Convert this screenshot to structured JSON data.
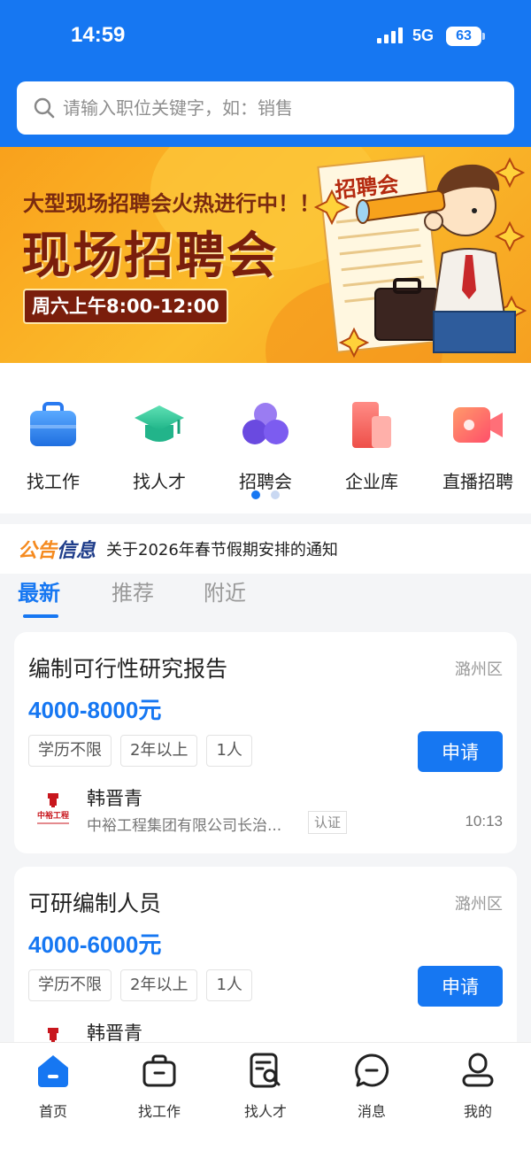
{
  "status_bar": {
    "time": "14:59",
    "network": "5G",
    "battery": "63"
  },
  "search": {
    "placeholder": "请输入职位关键字，如：销售"
  },
  "banner": {
    "subtitle": "大型现场招聘会火热进行中！！",
    "title": "现场招聘会",
    "time_badge": "周六上午8:00-12:00",
    "sign_text": "招聘会"
  },
  "quick_nav": {
    "items": [
      {
        "label": "找工作",
        "icon": "briefcase-icon"
      },
      {
        "label": "找人才",
        "icon": "graduation-cap-icon"
      },
      {
        "label": "招聘会",
        "icon": "job-fair-icon"
      },
      {
        "label": "企业库",
        "icon": "company-icon"
      },
      {
        "label": "直播招聘",
        "icon": "live-video-icon"
      }
    ],
    "page_count": 2,
    "current_page": 1
  },
  "notice": {
    "tag_part1": "公告",
    "tag_part2": "信息",
    "text": "关于2026年春节假期安排的通知"
  },
  "tabs": [
    {
      "label": "最新",
      "active": true
    },
    {
      "label": "推荐",
      "active": false
    },
    {
      "label": "附近",
      "active": false
    }
  ],
  "jobs": [
    {
      "title": "编制可行性研究报告",
      "district": "潞州区",
      "salary": "4000-8000元",
      "tags": [
        "学历不限",
        "2年以上",
        "1人"
      ],
      "apply_label": "申请",
      "contact": "韩晋青",
      "company": "中裕工程集团有限公司长治...",
      "cert": "认证",
      "time": "10:13",
      "logo_text": "中裕工程"
    },
    {
      "title": "可研编制人员",
      "district": "潞州区",
      "salary": "4000-6000元",
      "tags": [
        "学历不限",
        "2年以上",
        "1人"
      ],
      "apply_label": "申请",
      "contact": "韩晋青",
      "company": "",
      "cert": "",
      "time": "",
      "logo_text": ""
    }
  ],
  "bottom_nav": {
    "items": [
      {
        "label": "首页",
        "icon": "home-icon",
        "active": true
      },
      {
        "label": "找工作",
        "icon": "briefcase-outline-icon",
        "active": false
      },
      {
        "label": "找人才",
        "icon": "resume-search-icon",
        "active": false
      },
      {
        "label": "消息",
        "icon": "message-icon",
        "active": false
      },
      {
        "label": "我的",
        "icon": "profile-icon",
        "active": false
      }
    ]
  },
  "colors": {
    "primary": "#1677f2",
    "banner_orange": "#f9a11c",
    "banner_text": "#7a1e0c",
    "notice_orange": "#f58a1f",
    "notice_navy": "#1f3d8a"
  }
}
